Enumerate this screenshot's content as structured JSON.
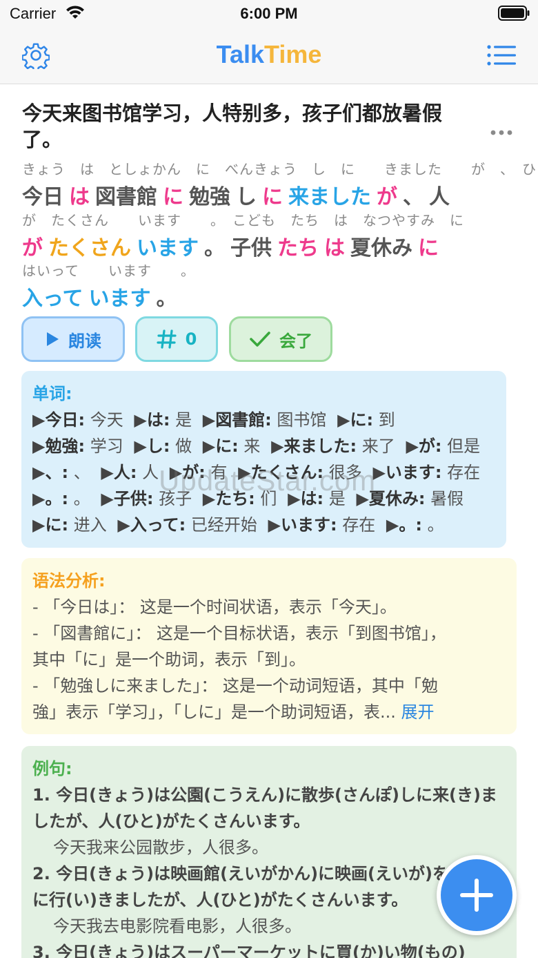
{
  "status_bar": {
    "carrier": "Carrier",
    "time": "6:00 PM"
  },
  "nav": {
    "title_part1": "Talk",
    "title_part2": "Time"
  },
  "sentence": {
    "text": "今天来图书馆学习，人特别多，孩子们都放暑假了。"
  },
  "furigana_lines": [
    "きょう　は　としょかん　に　べんきょう　し　に　　きました　　が　、　ひと",
    "が　たくさん　　います　　。　こども　たち　は　なつやすみ　に",
    "はいって　　います　　。"
  ],
  "word_lines": [
    [
      {
        "text": "今日",
        "color": "gray"
      },
      {
        "text": "は",
        "color": "pink"
      },
      {
        "text": "図書館",
        "color": "gray"
      },
      {
        "text": "に",
        "color": "pink"
      },
      {
        "text": "勉強",
        "color": "gray"
      },
      {
        "text": "し",
        "color": "gray"
      },
      {
        "text": "に",
        "color": "pink"
      },
      {
        "text": "来ました",
        "color": "blue"
      },
      {
        "text": "が",
        "color": "pink"
      },
      {
        "text": "、",
        "color": "gray"
      },
      {
        "text": "人",
        "color": "gray"
      }
    ],
    [
      {
        "text": "が",
        "color": "pink"
      },
      {
        "text": "たくさん",
        "color": "orange"
      },
      {
        "text": "います",
        "color": "blue"
      },
      {
        "text": "。",
        "color": "gray"
      },
      {
        "text": "子供",
        "color": "gray"
      },
      {
        "text": "たち",
        "color": "pink"
      },
      {
        "text": "は",
        "color": "pink"
      },
      {
        "text": "夏休み",
        "color": "gray"
      },
      {
        "text": "に",
        "color": "pink"
      }
    ],
    [
      {
        "text": "入って",
        "color": "blue"
      },
      {
        "text": "います",
        "color": "blue"
      },
      {
        "text": "。",
        "color": "gray"
      }
    ]
  ],
  "buttons": {
    "read": "朗读",
    "count": "0",
    "learned": "会了"
  },
  "vocab": {
    "title": "单词:",
    "items": [
      {
        "word": "今日:",
        "meaning": "今天"
      },
      {
        "word": "は:",
        "meaning": "是"
      },
      {
        "word": "図書館:",
        "meaning": "图书馆"
      },
      {
        "word": "に:",
        "meaning": "到"
      },
      {
        "word": "勉強:",
        "meaning": "学习"
      },
      {
        "word": "し:",
        "meaning": "做"
      },
      {
        "word": "に:",
        "meaning": "来"
      },
      {
        "word": "来ました:",
        "meaning": "来了"
      },
      {
        "word": "が:",
        "meaning": "但是"
      },
      {
        "word": "、:",
        "meaning": "、"
      },
      {
        "word": "人:",
        "meaning": "人"
      },
      {
        "word": "が:",
        "meaning": "有"
      },
      {
        "word": "たくさん:",
        "meaning": "很多"
      },
      {
        "word": "います:",
        "meaning": "存在"
      },
      {
        "word": "。:",
        "meaning": "。"
      },
      {
        "word": "子供:",
        "meaning": "孩子"
      },
      {
        "word": "たち:",
        "meaning": "们"
      },
      {
        "word": "は:",
        "meaning": "是"
      },
      {
        "word": "夏休み:",
        "meaning": "暑假"
      },
      {
        "word": "に:",
        "meaning": "进入"
      },
      {
        "word": "入って:",
        "meaning": "已经开始"
      },
      {
        "word": "います:",
        "meaning": "存在"
      },
      {
        "word": "。:",
        "meaning": "。"
      }
    ]
  },
  "grammar": {
    "title": "语法分析:",
    "lines": [
      "- 「今日は」： 这是一个时间状语，表示「今天」。",
      "- 「図書館に」： 这是一个目标状语，表示「到图书馆」，",
      "其中「に」是一个助词，表示「到」。",
      "- 「勉強しに来ました」： 这是一个动词短语，其中「勉",
      "強」表示「学习」，「しに」是一个助词短语，表..."
    ],
    "expand_label": "展开"
  },
  "examples": {
    "title": "例句:",
    "items": [
      {
        "jp": "1. 今日(きょう)は公園(こうえん)に散歩(さんぽ)しに来(き)ましたが、人(ひと)がたくさんいます。",
        "cn": "今天我来公园散步，人很多。"
      },
      {
        "jp": "2. 今日(きょう)は映画館(えいがかん)に映画(えいが)を見(み)に行(い)きましたが、人(ひと)がたくさんいます。",
        "cn": "今天我去电影院看电影，人很多。"
      },
      {
        "jp": "3. 今日(きょう)はスーパーマーケットに買(か)い物(もの)",
        "cn": ""
      }
    ]
  },
  "watermark": "UpdateStar.com"
}
